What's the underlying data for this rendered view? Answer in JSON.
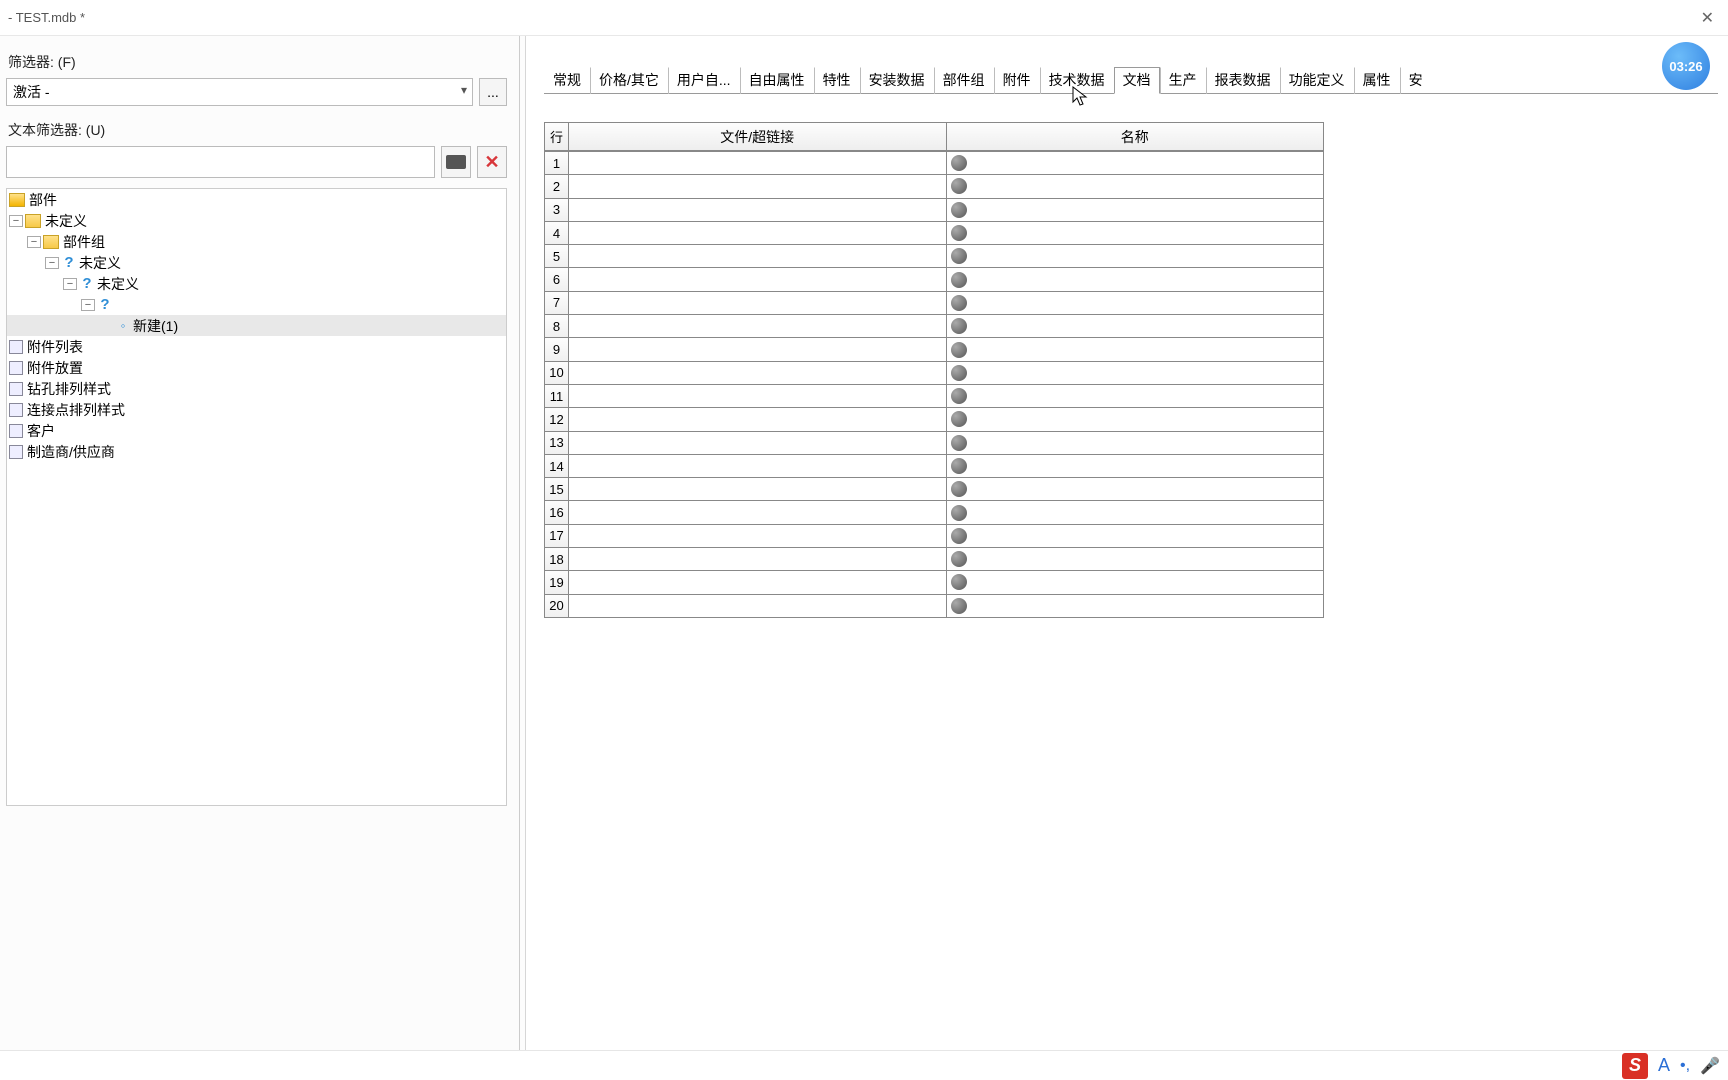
{
  "title": " - TEST.mdb *",
  "clock": "03:26",
  "left": {
    "filter_label": "筛选器: (F)",
    "filter_value": "激活 -",
    "dots": "...",
    "text_filter_label": "文本筛选器: (U)",
    "text_filter_value": ""
  },
  "tree": {
    "root": "部件",
    "n0": "未定义",
    "n1": "部件组",
    "n2": "未定义",
    "n3": "未定义",
    "n5": "新建(1)",
    "a0": "附件列表",
    "a1": "附件放置",
    "a2": "钻孔排列样式",
    "a3": "连接点排列样式",
    "a4": "客户",
    "a5": "制造商/供应商"
  },
  "tabs": [
    "常规",
    "价格/其它",
    "用户自...",
    "自由属性",
    "特性",
    "安装数据",
    "部件组",
    "附件",
    "技术数据",
    "文档",
    "生产",
    "报表数据",
    "功能定义",
    "属性",
    "安"
  ],
  "active_tab_index": 9,
  "table": {
    "h_row": "行",
    "h_file": "文件/超链接",
    "h_name": "名称",
    "rows": 20
  }
}
